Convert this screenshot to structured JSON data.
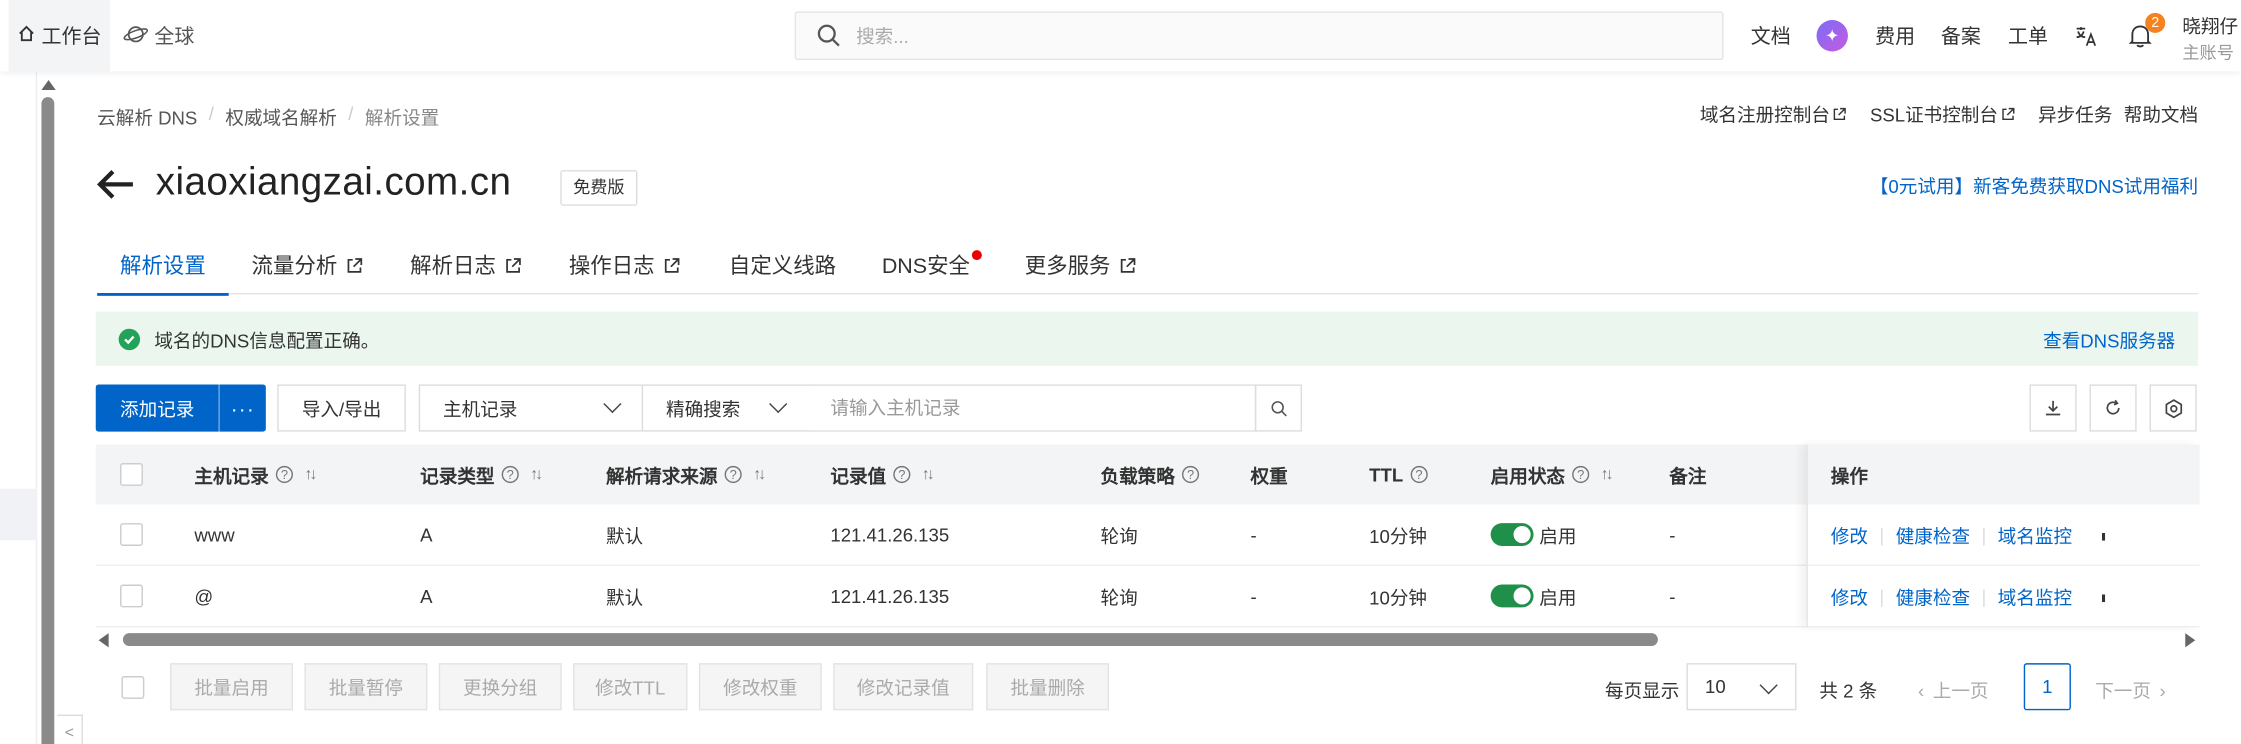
{
  "topbar": {
    "workbench": "工作台",
    "global": "全球",
    "search_placeholder": "搜索...",
    "docs": "文档",
    "fees": "费用",
    "filing": "备案",
    "ticket": "工单",
    "notification_count": "2",
    "user_name": "晓翔仔",
    "user_role": "主账号"
  },
  "breadcrumb": [
    "云解析 DNS",
    "权威域名解析",
    "解析设置"
  ],
  "top_links": {
    "domain_console": "域名注册控制台",
    "ssl_console": "SSL证书控制台",
    "async_tasks": "异步任务",
    "help_docs": "帮助文档"
  },
  "header": {
    "domain": "xiaoxiangzai.com.cn",
    "plan": "免费版",
    "promo": "【0元试用】新客免费获取DNS试用福利"
  },
  "tabs": [
    "解析设置",
    "流量分析",
    "解析日志",
    "操作日志",
    "自定义线路",
    "DNS安全",
    "更多服务"
  ],
  "alert": {
    "text": "域名的DNS信息配置正确。",
    "link": "查看DNS服务器"
  },
  "toolbar": {
    "add_record": "添加记录",
    "import_export": "导入/导出",
    "field_select": "主机记录",
    "match_select": "精确搜索",
    "search_placeholder": "请输入主机记录"
  },
  "table": {
    "headers": [
      "主机记录",
      "记录类型",
      "解析请求来源",
      "记录值",
      "负载策略",
      "权重",
      "TTL",
      "启用状态",
      "备注",
      "操作"
    ],
    "rows": [
      {
        "host": "www",
        "type": "A",
        "source": "默认",
        "value": "121.41.26.135",
        "policy": "轮询",
        "weight": "-",
        "ttl": "10分钟",
        "status": "启用",
        "note": "-"
      },
      {
        "host": "@",
        "type": "A",
        "source": "默认",
        "value": "121.41.26.135",
        "policy": "轮询",
        "weight": "-",
        "ttl": "10分钟",
        "status": "启用",
        "note": "-"
      }
    ],
    "actions": [
      "修改",
      "健康检查",
      "域名监控"
    ]
  },
  "footer": {
    "batch": [
      "批量启用",
      "批量暂停",
      "更换分组",
      "修改TTL",
      "修改权重",
      "修改记录值",
      "批量删除"
    ],
    "per_page_label": "每页显示",
    "per_page": "10",
    "total": "共 2 条",
    "prev": "上一页",
    "next": "下一页",
    "current_page": "1"
  },
  "colors": {
    "primary": "#0064c8",
    "success": "#23a35a",
    "alert_bg": "#ebf7ee",
    "badge": "#f5821f"
  }
}
